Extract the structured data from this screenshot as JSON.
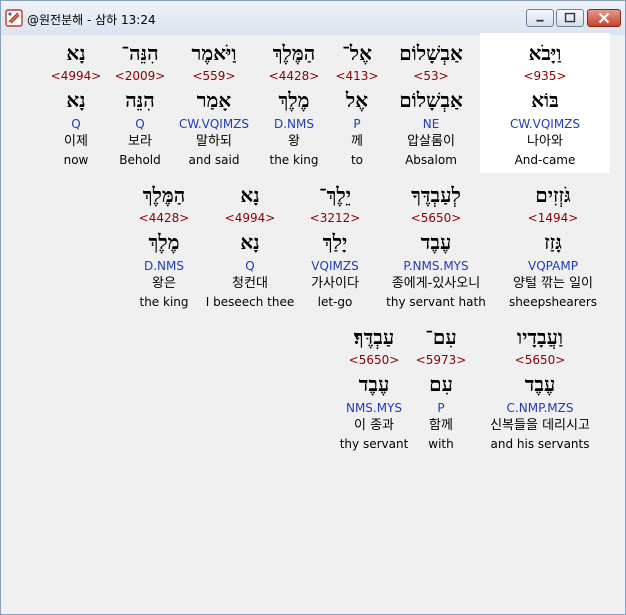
{
  "window": {
    "title": "@원전분해 - 삼하 13:24"
  },
  "lines": [
    [
      {
        "heb": "נָא",
        "num": "<4994>",
        "root": "נָא",
        "morph": "Q",
        "kor": "이제",
        "eng": "now"
      },
      {
        "heb": "הִנֵּה־",
        "num": "<2009>",
        "root": "הִנֵּה",
        "morph": "Q",
        "kor": "보라",
        "eng": "Behold"
      },
      {
        "heb": "וַיֹּאמֶר",
        "num": "<559>",
        "root": "אָמַר",
        "morph": "CW.VQIMZS",
        "kor": "말하되",
        "eng": "and said"
      },
      {
        "heb": "הַמֶּלֶךְ",
        "num": "<4428>",
        "root": "מֶלֶךְ",
        "morph": "D.NMS",
        "kor": "왕",
        "eng": "the king"
      },
      {
        "heb": "אֶל־",
        "num": "<413>",
        "root": "אֶל",
        "morph": "P",
        "kor": "께",
        "eng": "to"
      },
      {
        "heb": "אַבְשָׁלוֹם",
        "num": "<53>",
        "root": "אַבְשָׁלוֹם",
        "morph": "NE",
        "kor": "압살롬이",
        "eng": "Absalom"
      },
      {
        "heb": "וַיָּבֹא",
        "num": "<935>",
        "root": "בּוֹא",
        "morph": "CW.VQIMZS",
        "kor": "나아와",
        "eng": "And-came",
        "selected": true
      }
    ],
    [
      {
        "heb": "הַמֶּלֶךְ",
        "num": "<4428>",
        "root": "מֶלֶךְ",
        "morph": "D.NMS",
        "kor": "왕은",
        "eng": "the king"
      },
      {
        "heb": "נָא",
        "num": "<4994>",
        "root": "נָא",
        "morph": "Q",
        "kor": "청컨대",
        "eng": "I beseech thee"
      },
      {
        "heb": "יֵלֶךְ־",
        "num": "<3212>",
        "root": "יָלַךְ",
        "morph": "VQIMZS",
        "kor": "가사이다",
        "eng": "let-go"
      },
      {
        "heb": "לְעַבְדֶּךָ",
        "num": "<5650>",
        "root": "עֶבֶד",
        "morph": "P.NMS.MYS",
        "kor": "종에게-있사오니",
        "eng": "thy servant hath"
      },
      {
        "heb": "גֹּזְזִים",
        "num": "<1494>",
        "root": "גָּזַז",
        "morph": "VQPAMP",
        "kor": "양털 깎는 일이",
        "eng": "sheepshearers"
      }
    ],
    [
      {
        "heb": "עַבְדֶּךָ׃",
        "num": "<5650>",
        "root": "עֶבֶד",
        "morph": "NMS.MYS",
        "kor": "이 종과",
        "eng": "thy servant"
      },
      {
        "heb": "עִם־",
        "num": "<5973>",
        "root": "עִם",
        "morph": "P",
        "kor": "함께",
        "eng": "with"
      },
      {
        "heb": "וַעֲבָדָיו",
        "num": "<5650>",
        "root": "עֶבֶד",
        "morph": "C.NMP.MZS",
        "kor": "신복들을 데리시고",
        "eng": "and his servants"
      }
    ]
  ]
}
